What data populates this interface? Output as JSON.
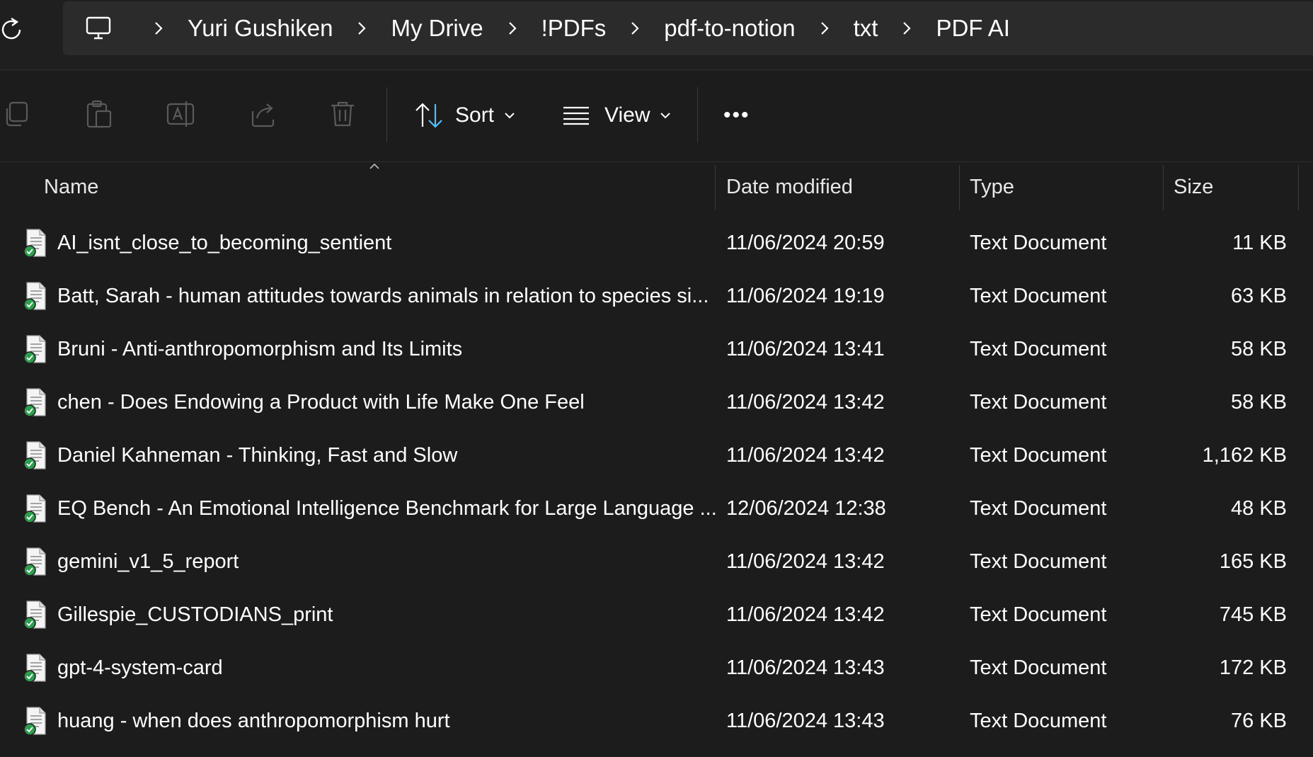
{
  "breadcrumb": {
    "items": [
      "Yuri Gushiken",
      "My Drive",
      "!PDFs",
      "pdf-to-notion",
      "txt",
      "PDF AI"
    ]
  },
  "toolbar": {
    "sort_label": "Sort",
    "view_label": "View",
    "more_label": "•••"
  },
  "columns": {
    "name": "Name",
    "date": "Date modified",
    "type": "Type",
    "size": "Size"
  },
  "files": [
    {
      "name": "AI_isnt_close_to_becoming_sentient",
      "date": "11/06/2024 20:59",
      "type": "Text Document",
      "size": "11 KB"
    },
    {
      "name": "Batt, Sarah - human attitudes towards animals in relation to species si...",
      "date": "11/06/2024 19:19",
      "type": "Text Document",
      "size": "63 KB"
    },
    {
      "name": "Bruni - Anti-anthropomorphism and Its Limits",
      "date": "11/06/2024 13:41",
      "type": "Text Document",
      "size": "58 KB"
    },
    {
      "name": "chen - Does Endowing a Product with Life Make One Feel",
      "date": "11/06/2024 13:42",
      "type": "Text Document",
      "size": "58 KB"
    },
    {
      "name": "Daniel Kahneman - Thinking, Fast and Slow",
      "date": "11/06/2024 13:42",
      "type": "Text Document",
      "size": "1,162 KB"
    },
    {
      "name": "EQ Bench - An Emotional Intelligence Benchmark for Large Language ...",
      "date": "12/06/2024 12:38",
      "type": "Text Document",
      "size": "48 KB"
    },
    {
      "name": "gemini_v1_5_report",
      "date": "11/06/2024 13:42",
      "type": "Text Document",
      "size": "165 KB"
    },
    {
      "name": "Gillespie_CUSTODIANS_print",
      "date": "11/06/2024 13:42",
      "type": "Text Document",
      "size": "745 KB"
    },
    {
      "name": "gpt-4-system-card",
      "date": "11/06/2024 13:43",
      "type": "Text Document",
      "size": "172 KB"
    },
    {
      "name": "huang - when does anthropomorphism hurt",
      "date": "11/06/2024 13:43",
      "type": "Text Document",
      "size": "76 KB"
    }
  ],
  "colors": {
    "background": "#1c1c1c",
    "addressbar": "#2b2b2b",
    "accent": "#4cc2ff",
    "sync_green": "#2e9e4f"
  }
}
